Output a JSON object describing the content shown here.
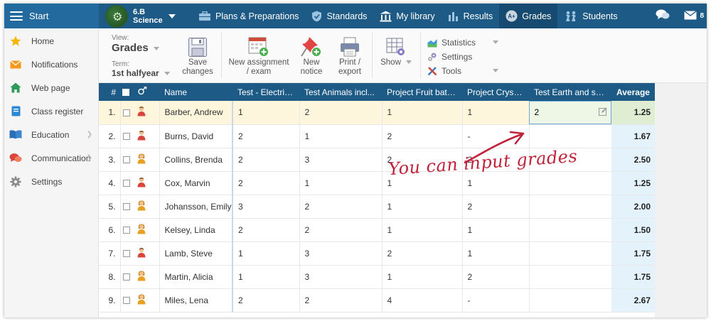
{
  "topbar": {
    "start_label": "Start",
    "class_line1": "6.B",
    "class_line2": "Science",
    "nav": [
      {
        "label": "Plans & Preparations",
        "icon": "briefcase-icon"
      },
      {
        "label": "Standards",
        "icon": "shield-icon"
      },
      {
        "label": "My library",
        "icon": "library-icon"
      },
      {
        "label": "Results",
        "icon": "bar-chart-icon"
      },
      {
        "label": "Grades",
        "icon": "grades-icon",
        "active": true
      },
      {
        "label": "Students",
        "icon": "students-icon"
      }
    ],
    "mail_count": "8"
  },
  "sidebar": {
    "items": [
      {
        "label": "Home",
        "icon": "star-icon"
      },
      {
        "label": "Notifications",
        "icon": "envelope-icon"
      },
      {
        "label": "Web page",
        "icon": "home-icon"
      },
      {
        "label": "Class register",
        "icon": "register-icon"
      },
      {
        "label": "Education",
        "icon": "book-icon",
        "has_children": true
      },
      {
        "label": "Communication",
        "icon": "chat-icon",
        "has_children": true
      },
      {
        "label": "Settings",
        "icon": "gear-icon"
      }
    ]
  },
  "toolbar": {
    "view_label": "View:",
    "view_value": "Grades",
    "term_label": "Term:",
    "term_value": "1st halfyear",
    "save_line1": "Save",
    "save_line2": "changes",
    "new_assignment_line1": "New assignment",
    "new_assignment_line2": "/ exam",
    "new_notice_line1": "New",
    "new_notice_line2": "notice",
    "print_line1": "Print /",
    "print_line2": "export",
    "show_label": "Show",
    "statistics_label": "Statistics",
    "settings_label": "Settings",
    "tools_label": "Tools"
  },
  "grid": {
    "headers": {
      "num": "#",
      "name": "Name",
      "columns": [
        "Test - Electricity",
        "Test Animals incl...",
        "Project Fruit battery",
        "Project Crystals",
        "Test Earth and sp..."
      ],
      "average": "Average"
    },
    "rows": [
      {
        "num": "1.",
        "name": "Barber, Andrew",
        "grades": [
          "1",
          "2",
          "1",
          "1",
          "2"
        ],
        "average": "1.25",
        "gender": "male"
      },
      {
        "num": "2.",
        "name": "Burns, David",
        "grades": [
          "2",
          "1",
          "2",
          "-",
          ""
        ],
        "average": "1.67",
        "gender": "male"
      },
      {
        "num": "3.",
        "name": "Collins, Brenda",
        "grades": [
          "2",
          "3",
          "2",
          "2",
          ""
        ],
        "average": "2.50",
        "gender": "female"
      },
      {
        "num": "4.",
        "name": "Cox, Marvin",
        "grades": [
          "2",
          "1",
          "1",
          "1",
          ""
        ],
        "average": "1.25",
        "gender": "male"
      },
      {
        "num": "5.",
        "name": "Johansson, Emily",
        "grades": [
          "3",
          "2",
          "1",
          "2",
          ""
        ],
        "average": "2.00",
        "gender": "female"
      },
      {
        "num": "6.",
        "name": "Kelsey, Linda",
        "grades": [
          "2",
          "2",
          "1",
          "1",
          ""
        ],
        "average": "1.50",
        "gender": "female"
      },
      {
        "num": "7.",
        "name": "Lamb, Steve",
        "grades": [
          "1",
          "3",
          "2",
          "1",
          ""
        ],
        "average": "1.75",
        "gender": "male"
      },
      {
        "num": "8.",
        "name": "Martin, Alicia",
        "grades": [
          "1",
          "3",
          "1",
          "2",
          ""
        ],
        "average": "1.75",
        "gender": "female"
      },
      {
        "num": "9.",
        "name": "Miles, Lena",
        "grades": [
          "2",
          "2",
          "4",
          "-",
          ""
        ],
        "average": "2.67",
        "gender": "female"
      }
    ],
    "selected_row": 0
  },
  "annotation": {
    "text": "You can input grades"
  },
  "colors": {
    "topbar": "#1d5a86",
    "selected_row": "#fdf5dc",
    "average_col": "#e4f2fc",
    "annotation": "#c0223a"
  }
}
